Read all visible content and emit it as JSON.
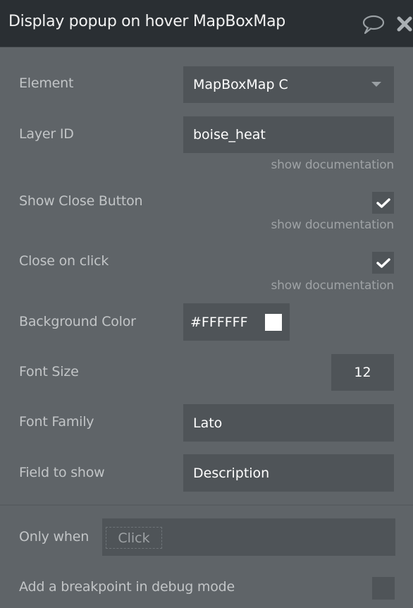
{
  "header": {
    "title": "Display popup on hover MapBoxMap",
    "icons": {
      "comment": "speech-bubble-icon",
      "close": "close-icon"
    }
  },
  "form": {
    "element": {
      "label": "Element",
      "value": "MapBoxMap C",
      "icon": "chevron-down-icon"
    },
    "layer_id": {
      "label": "Layer ID",
      "value": "boise_heat",
      "doc_link": "show documentation"
    },
    "show_close_button": {
      "label": "Show Close Button",
      "checked": true,
      "doc_link": "show documentation"
    },
    "close_on_click": {
      "label": "Close on click",
      "checked": true,
      "doc_link": "show documentation"
    },
    "background_color": {
      "label": "Background Color",
      "value": "#FFFFFF",
      "swatch_color": "#FFFFFF"
    },
    "font_size": {
      "label": "Font Size",
      "value": "12"
    },
    "font_family": {
      "label": "Font Family",
      "value": "Lato"
    },
    "field_to_show": {
      "label": "Field to show",
      "value": "Description"
    }
  },
  "conditions": {
    "only_when": {
      "label": "Only when",
      "placeholder": "Click"
    },
    "breakpoint": {
      "label": "Add a breakpoint in debug mode",
      "checked": false
    }
  },
  "colors": {
    "header_bg": "#2a2f33",
    "panel_bg": "#5f6468",
    "field_bg": "#4f5458"
  }
}
